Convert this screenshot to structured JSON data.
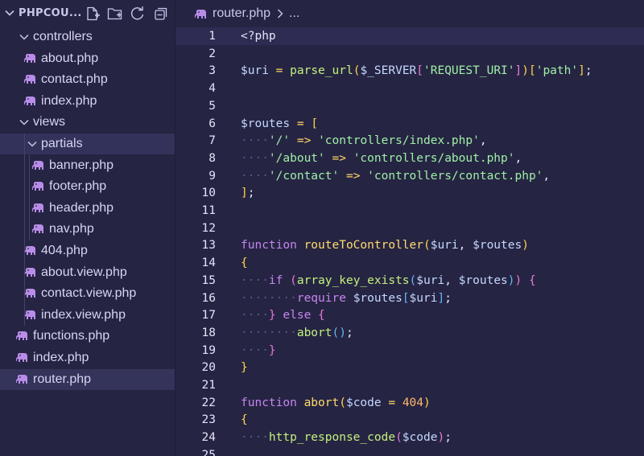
{
  "sidebar": {
    "project_title": "PHPCOU...",
    "actions": [
      {
        "name": "new-file-button",
        "icon": "new-file-icon"
      },
      {
        "name": "new-folder-button",
        "icon": "new-folder-icon"
      },
      {
        "name": "refresh-button",
        "icon": "refresh-icon"
      },
      {
        "name": "collapse-all-button",
        "icon": "collapse-all-icon"
      }
    ],
    "items": [
      {
        "label": "controllers",
        "type": "folder",
        "open": true,
        "depth": 1
      },
      {
        "label": "about.php",
        "type": "file",
        "depth": 2
      },
      {
        "label": "contact.php",
        "type": "file",
        "depth": 2
      },
      {
        "label": "index.php",
        "type": "file",
        "depth": 2
      },
      {
        "label": "views",
        "type": "folder",
        "open": true,
        "depth": 1
      },
      {
        "label": "partials",
        "type": "folder",
        "open": true,
        "depth": 2,
        "selected": true
      },
      {
        "label": "banner.php",
        "type": "file",
        "depth": 3
      },
      {
        "label": "footer.php",
        "type": "file",
        "depth": 3
      },
      {
        "label": "header.php",
        "type": "file",
        "depth": 3
      },
      {
        "label": "nav.php",
        "type": "file",
        "depth": 3
      },
      {
        "label": "404.php",
        "type": "file",
        "depth": 2
      },
      {
        "label": "about.view.php",
        "type": "file",
        "depth": 2
      },
      {
        "label": "contact.view.php",
        "type": "file",
        "depth": 2
      },
      {
        "label": "index.view.php",
        "type": "file",
        "depth": 2
      },
      {
        "label": "functions.php",
        "type": "file",
        "depth": 1
      },
      {
        "label": "index.php",
        "type": "file",
        "depth": 1
      },
      {
        "label": "router.php",
        "type": "file",
        "depth": 1,
        "active": true
      }
    ]
  },
  "breadcrumb": {
    "file": "router.php",
    "more": "..."
  },
  "editor": {
    "current_line": 1,
    "lines": [
      {
        "n": "1",
        "t": [
          [
            "<?php",
            "tag"
          ]
        ]
      },
      {
        "n": "2",
        "t": []
      },
      {
        "n": "3",
        "t": [
          [
            "$uri",
            "var"
          ],
          [
            " ",
            "plain"
          ],
          [
            "=",
            "op"
          ],
          [
            " ",
            "plain"
          ],
          [
            "parse_url",
            "fn"
          ],
          [
            "(",
            "br1"
          ],
          [
            "$_SERVER",
            "var"
          ],
          [
            "[",
            "br2"
          ],
          [
            "'REQUEST_URI'",
            "str"
          ],
          [
            "]",
            "br2"
          ],
          [
            ")",
            "br1"
          ],
          [
            "[",
            "br1"
          ],
          [
            "'path'",
            "str"
          ],
          [
            "]",
            "br1"
          ],
          [
            ";",
            "punc"
          ]
        ]
      },
      {
        "n": "4",
        "t": []
      },
      {
        "n": "5",
        "t": []
      },
      {
        "n": "6",
        "t": [
          [
            "$routes",
            "var"
          ],
          [
            " ",
            "plain"
          ],
          [
            "=",
            "op"
          ],
          [
            " ",
            "plain"
          ],
          [
            "[",
            "br1"
          ]
        ]
      },
      {
        "n": "7",
        "t": [
          [
            "····",
            "ws"
          ],
          [
            "'/'",
            "str"
          ],
          [
            " ",
            "plain"
          ],
          [
            "=>",
            "op"
          ],
          [
            " ",
            "plain"
          ],
          [
            "'controllers/index.php'",
            "str"
          ],
          [
            ",",
            "punc"
          ]
        ]
      },
      {
        "n": "8",
        "t": [
          [
            "····",
            "ws"
          ],
          [
            "'/about'",
            "str"
          ],
          [
            " ",
            "plain"
          ],
          [
            "=>",
            "op"
          ],
          [
            " ",
            "plain"
          ],
          [
            "'controllers/about.php'",
            "str"
          ],
          [
            ",",
            "punc"
          ]
        ]
      },
      {
        "n": "9",
        "t": [
          [
            "····",
            "ws"
          ],
          [
            "'/contact'",
            "str"
          ],
          [
            " ",
            "plain"
          ],
          [
            "=>",
            "op"
          ],
          [
            " ",
            "plain"
          ],
          [
            "'controllers/contact.php'",
            "str"
          ],
          [
            ",",
            "punc"
          ]
        ]
      },
      {
        "n": "10",
        "t": [
          [
            "]",
            "br1"
          ],
          [
            ";",
            "punc"
          ]
        ]
      },
      {
        "n": "11",
        "t": []
      },
      {
        "n": "12",
        "t": []
      },
      {
        "n": "13",
        "t": [
          [
            "function",
            "kw"
          ],
          [
            " ",
            "plain"
          ],
          [
            "routeToController",
            "fndef"
          ],
          [
            "(",
            "br1"
          ],
          [
            "$uri",
            "var"
          ],
          [
            ",",
            "punc"
          ],
          [
            " ",
            "plain"
          ],
          [
            "$routes",
            "var"
          ],
          [
            ")",
            "br1"
          ]
        ]
      },
      {
        "n": "14",
        "t": [
          [
            "{",
            "br1"
          ]
        ]
      },
      {
        "n": "15",
        "t": [
          [
            "····",
            "ws"
          ],
          [
            "if",
            "kw"
          ],
          [
            " ",
            "plain"
          ],
          [
            "(",
            "br2"
          ],
          [
            "array_key_exists",
            "fn"
          ],
          [
            "(",
            "br3"
          ],
          [
            "$uri",
            "var"
          ],
          [
            ",",
            "punc"
          ],
          [
            " ",
            "plain"
          ],
          [
            "$routes",
            "var"
          ],
          [
            ")",
            "br3"
          ],
          [
            ")",
            "br2"
          ],
          [
            " ",
            "plain"
          ],
          [
            "{",
            "br2"
          ]
        ]
      },
      {
        "n": "16",
        "t": [
          [
            "········",
            "ws"
          ],
          [
            "require",
            "kw"
          ],
          [
            " ",
            "plain"
          ],
          [
            "$routes",
            "var"
          ],
          [
            "[",
            "br3"
          ],
          [
            "$uri",
            "var"
          ],
          [
            "]",
            "br3"
          ],
          [
            ";",
            "punc"
          ]
        ]
      },
      {
        "n": "17",
        "t": [
          [
            "····",
            "ws"
          ],
          [
            "}",
            "br2"
          ],
          [
            " ",
            "plain"
          ],
          [
            "else",
            "kw"
          ],
          [
            " ",
            "plain"
          ],
          [
            "{",
            "br2"
          ]
        ]
      },
      {
        "n": "18",
        "t": [
          [
            "········",
            "ws"
          ],
          [
            "abort",
            "fn"
          ],
          [
            "(",
            "br3"
          ],
          [
            ")",
            "br3"
          ],
          [
            ";",
            "punc"
          ]
        ]
      },
      {
        "n": "19",
        "t": [
          [
            "····",
            "ws"
          ],
          [
            "}",
            "br2"
          ]
        ]
      },
      {
        "n": "20",
        "t": [
          [
            "}",
            "br1"
          ]
        ]
      },
      {
        "n": "21",
        "t": []
      },
      {
        "n": "22",
        "t": [
          [
            "function",
            "kw"
          ],
          [
            " ",
            "plain"
          ],
          [
            "abort",
            "fndef"
          ],
          [
            "(",
            "br1"
          ],
          [
            "$code",
            "var"
          ],
          [
            " ",
            "plain"
          ],
          [
            "=",
            "op"
          ],
          [
            " ",
            "plain"
          ],
          [
            "404",
            "num"
          ],
          [
            ")",
            "br1"
          ]
        ]
      },
      {
        "n": "23",
        "t": [
          [
            "{",
            "br1"
          ]
        ]
      },
      {
        "n": "24",
        "t": [
          [
            "····",
            "ws"
          ],
          [
            "http_response_code",
            "fn"
          ],
          [
            "(",
            "br2"
          ],
          [
            "$code",
            "var"
          ],
          [
            ")",
            "br2"
          ],
          [
            ";",
            "punc"
          ]
        ]
      },
      {
        "n": "25",
        "t": []
      }
    ]
  },
  "colors": {
    "background": "#262443",
    "selected_row": "#33325a",
    "php_icon": "#b88ce8"
  }
}
